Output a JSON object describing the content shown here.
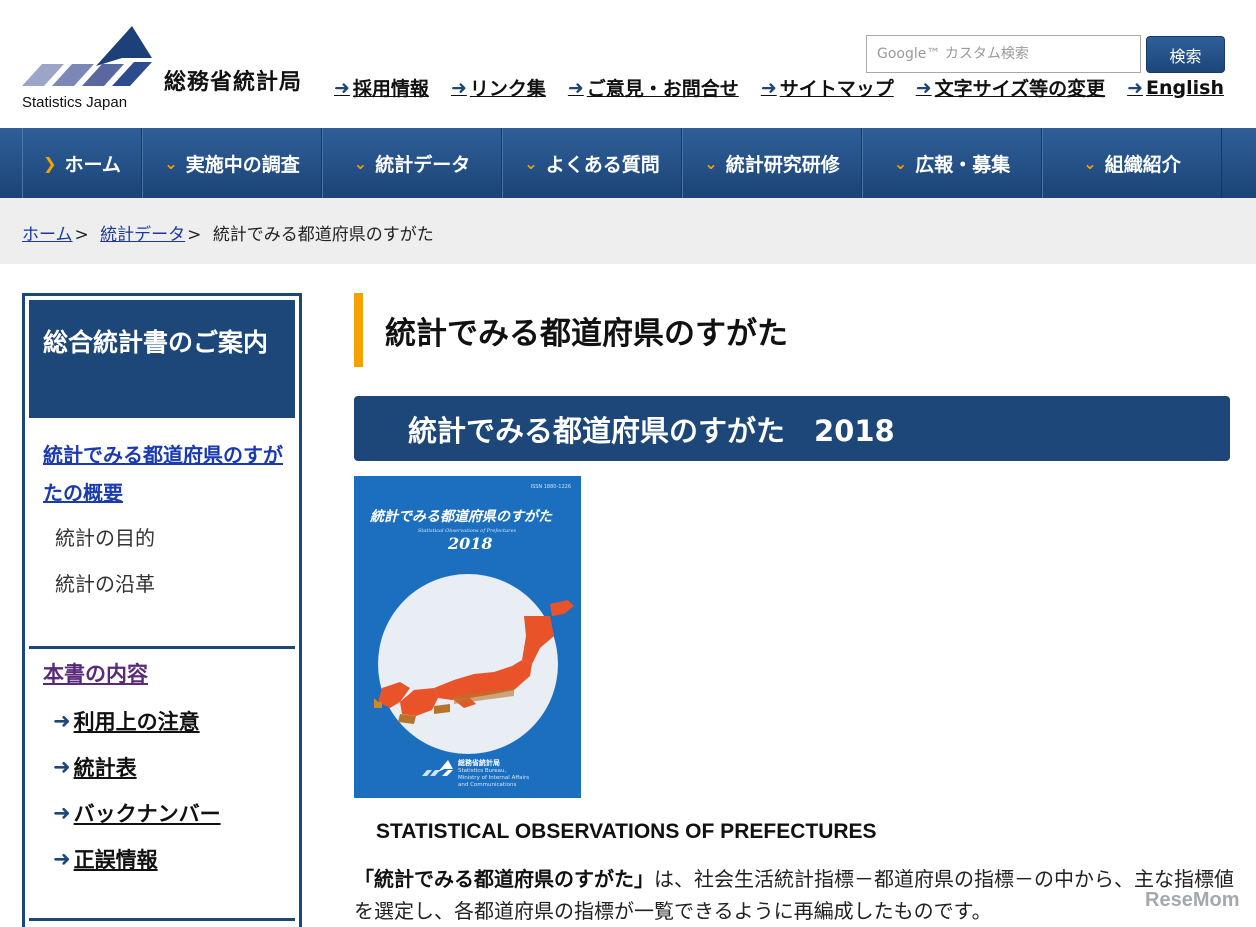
{
  "header": {
    "logo_jp": "総務省統計局",
    "logo_en": "Statistics Japan",
    "search": {
      "placeholder": "カスタム検索",
      "google_label": "Google",
      "button_label": "検索"
    },
    "links": [
      "採用情報",
      "リンク集",
      "ご意見・お問合せ",
      "サイトマップ",
      "文字サイズ等の変更",
      "English"
    ]
  },
  "nav": {
    "items": [
      "ホーム",
      "実施中の調査",
      "統計データ",
      "よくある質問",
      "統計研究研修",
      "広報・募集",
      "組織紹介"
    ]
  },
  "breadcrumb": {
    "home": "ホーム",
    "data": "統計データ",
    "current": "統計でみる都道府県のすがた",
    "sep": ">"
  },
  "sidebar": {
    "heading": "総合統計書のご案内",
    "summary_link": "統計でみる都道府県のすがたの概要",
    "sub_items": [
      "統計の目的",
      "統計の沿革"
    ],
    "section_title": "本書の内容",
    "links": [
      "利用上の注意",
      "統計表",
      "バックナンバー",
      "正誤情報"
    ]
  },
  "main": {
    "page_title": "統計でみる都道府県のすがた",
    "section_title": "統計でみる都道府県のすがた　2018",
    "cover": {
      "title": "統計でみる都道府県のすがた",
      "subtitle_en": "Statistical Observations of Prefectures",
      "year": "2018",
      "isbn": "ISSN 1880-1226",
      "publisher_jp": "総務省統計局",
      "publisher_en": "Statistics Bureau,",
      "publisher_en2": "Ministry of Internal Affairs",
      "publisher_en3": "and Communications"
    },
    "english_title": "STATISTICAL OBSERVATIONS OF PREFECTURES",
    "desc_bold": "「統計でみる都道府県のすがた」",
    "desc_rest": "は、社会生活統計指標－都道府県の指標－の中から、主な指標値を選定し、各都道府県の指標が一覧できるように再編成したものです。"
  },
  "watermark": "ReseMom",
  "colors": {
    "navy": "#1d4679",
    "accent": "#f5a200",
    "cover_blue": "#1c6fbf",
    "map_orange": "#e8532a"
  }
}
